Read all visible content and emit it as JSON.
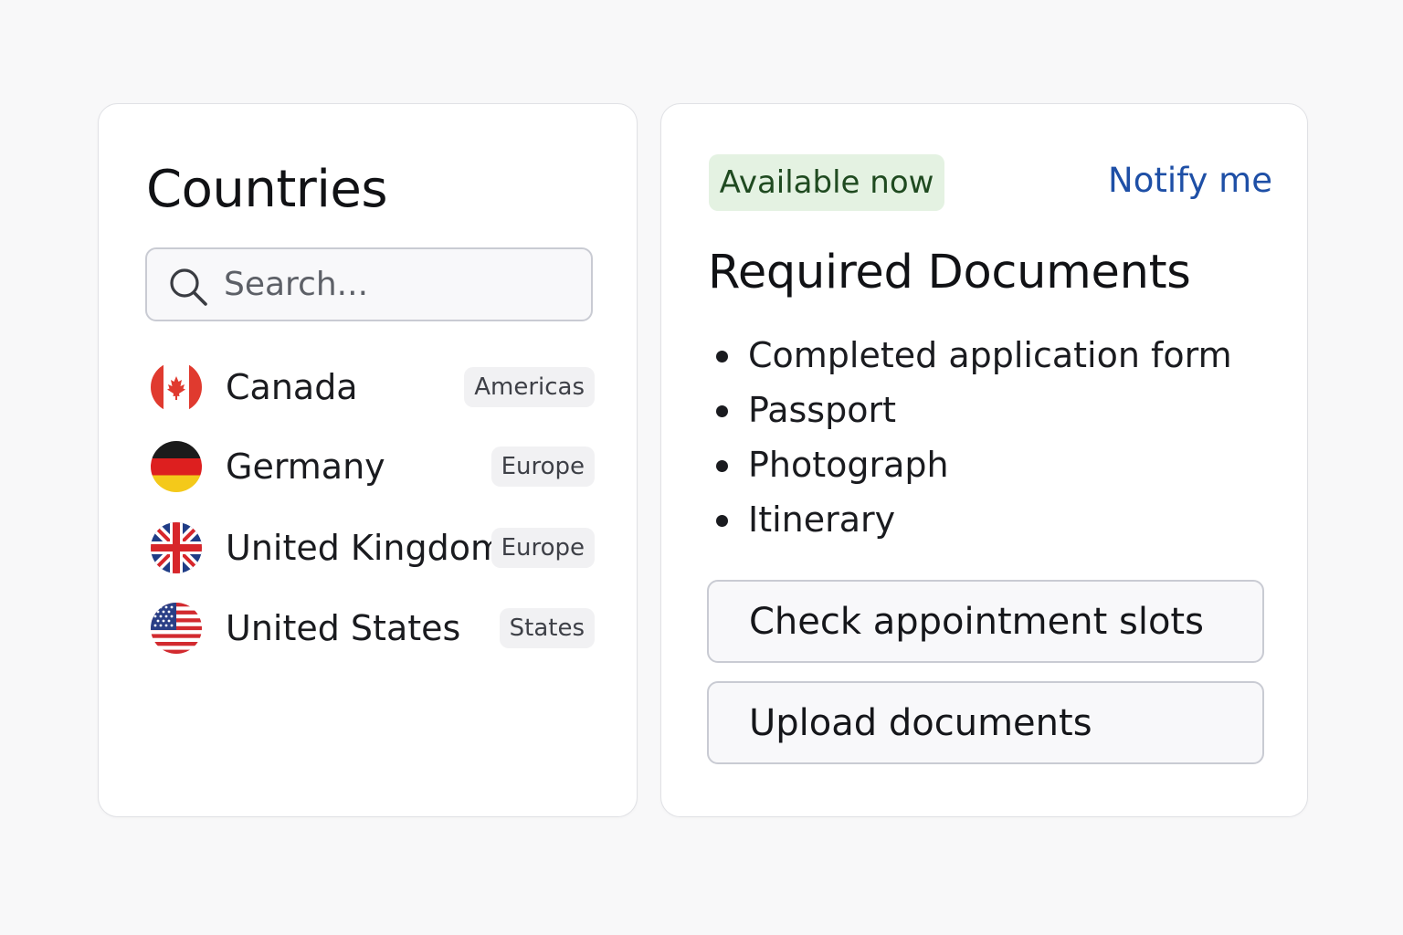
{
  "countries_panel": {
    "title": "Countries",
    "search": {
      "placeholder": "Search...",
      "value": ""
    },
    "items": [
      {
        "name": "Canada",
        "region": "Americas",
        "flag": "canada-flag-icon"
      },
      {
        "name": "Germany",
        "region": "Europe",
        "flag": "germany-flag-icon"
      },
      {
        "name": "United Kingdom",
        "region": "Europe",
        "flag": "uk-flag-icon"
      },
      {
        "name": "United States",
        "region": "States",
        "flag": "us-flag-icon"
      }
    ]
  },
  "documents_panel": {
    "status": "Available now",
    "notify_label": "Notify me",
    "title": "Required Documents",
    "documents": [
      "Completed application form",
      "Passport",
      "Photograph",
      "Itinerary"
    ],
    "buttons": {
      "check_slots": "Check appointment slots",
      "upload": "Upload documents"
    }
  },
  "colors": {
    "status_bg": "#e4f2e2",
    "status_text": "#1f4a20",
    "link": "#1e4fa6",
    "badge_bg": "#f1f1f3"
  }
}
